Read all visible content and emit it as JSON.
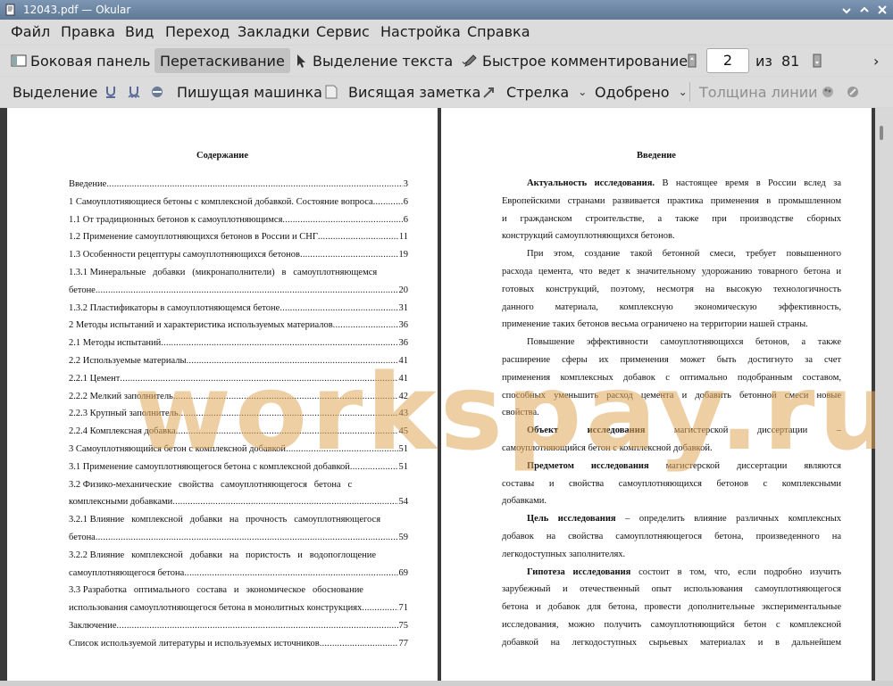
{
  "window": {
    "title": "12043.pdf  — Okular"
  },
  "menubar": {
    "items": [
      "Файл",
      "Правка",
      "Вид",
      "Переход",
      "Закладки",
      "Сервис",
      "Настройка",
      "Справка"
    ]
  },
  "toolbar1": {
    "sidebar": "Боковая панель",
    "drag": "Перетаскивание",
    "text_select": "Выделение текста",
    "quick_comment": "Быстрое комментирование",
    "page_value": "2",
    "page_of": "из",
    "page_total": "81"
  },
  "toolbar2": {
    "selection": "Выделение",
    "typewriter": "Пишущая машинка",
    "hanging_note": "Висящая заметка",
    "arrow": "Стрелка",
    "approved": "Одобрено",
    "line_width": "Толщина линии"
  },
  "left_page": {
    "heading": "Содержание",
    "toc": [
      {
        "title": "Введение",
        "page": "3"
      },
      {
        "title": "1 Самоуплотняющиеся бетоны с комплексной добавкой. Состояние вопроса",
        "page": "6"
      },
      {
        "title": "1.1 От традиционных бетонов к самоуплотняющимся",
        "page": "6"
      },
      {
        "title": "1.2 Применение самоуплотняющихся бетонов в России и СНГ",
        "page": "11"
      },
      {
        "title": "1.3 Особенности рецептуры самоуплотняющихся бетонов",
        "page": "19"
      },
      {
        "title": "1.3.1 Минеральные   добавки   (микронаполнители)   в   самоуплотняющемся",
        "page": ""
      },
      {
        "title": "бетоне",
        "page": "20"
      },
      {
        "title": "1.3.2 Пластификаторы в самоуплотняющемся бетоне",
        "page": "31"
      },
      {
        "title": "2 Методы испытаний и характеристика используемых материалов",
        "page": "36"
      },
      {
        "title": "2.1 Методы испытаний",
        "page": "36"
      },
      {
        "title": "2.2 Используемые материалы",
        "page": "41"
      },
      {
        "title": "2.2.1 Цемент",
        "page": "41"
      },
      {
        "title": "2.2.2 Мелкий заполнитель",
        "page": "42"
      },
      {
        "title": "2.2.3 Крупный заполнитель",
        "page": "43"
      },
      {
        "title": "2.2.4 Комплексная добавка",
        "page": "45"
      },
      {
        "title": "3 Самоуплотняющийся бетон с комплексной добавкой",
        "page": "51"
      },
      {
        "title": "3.1 Применение самоуплотняющегося бетона с комплексной добавкой",
        "page": "51"
      },
      {
        "title": "3.2 Физико-механические   свойства   самоуплотняющегося   бетона   с",
        "page": ""
      },
      {
        "title": "комплексными добавками",
        "page": "54"
      },
      {
        "title": "3.2.1 Влияние   комплексной   добавки   на   прочность   самоуплотняющегося",
        "page": ""
      },
      {
        "title": "бетона",
        "page": "59"
      },
      {
        "title": "3.2.2 Влияние   комплексной   добавки   на   пористость   и   водопоглощение",
        "page": ""
      },
      {
        "title": "самоуплотняющегося бетона",
        "page": "69"
      },
      {
        "title": "3.3 Разработка   оптимального   состава   и   экономическое   обоснование",
        "page": ""
      },
      {
        "title": "использования самоуплотняющегося бетона в монолитных конструкциях",
        "page": "71"
      },
      {
        "title": "Заключение",
        "page": "75"
      },
      {
        "title": "Список используемой литературы и используемых источников",
        "page": "77"
      }
    ]
  },
  "right_page": {
    "heading": "Введение",
    "lines": [
      {
        "b": "Актуальность исследования.",
        "t": " В настоящее время в России вслед за",
        "indent": true
      },
      {
        "b": "",
        "t": "Европейскими странами развивается практика применения в промышленном"
      },
      {
        "b": "",
        "t": "и   гражданском   строительстве,   а   также   при   производстве   сборных"
      },
      {
        "b": "",
        "t": "конструкций самоуплотняющихся бетонов.",
        "last": true
      },
      {
        "b": "",
        "t": "При этом, создание такой бетонной смеси, требует повышенного",
        "indent": true
      },
      {
        "b": "",
        "t": "расхода цемента, что ведет к значительному удорожанию товарного бетона и"
      },
      {
        "b": "",
        "t": "готовых конструкций, поэтому, несмотря на высокую технологичность"
      },
      {
        "b": "",
        "t": "данного   материала,   комплексную   экономическую   эффективность,"
      },
      {
        "b": "",
        "t": "применение таких бетонов весьма ограничено на территории нашей страны.",
        "last": true
      },
      {
        "b": "",
        "t": "Повышение эффективности самоуплотняющихся бетонов, а также",
        "indent": true
      },
      {
        "b": "",
        "t": "расширение   сферы   их   применения   может   быть   достигнуто   за   счет"
      },
      {
        "b": "",
        "t": "применения комплексных добавок с оптимально подобранным составом,"
      },
      {
        "b": "",
        "t": "способных уменьшить расход цемента и добавить бетонной смеси новые"
      },
      {
        "b": "",
        "t": "свойства.",
        "last": true
      },
      {
        "b": "Объект     исследования",
        "t": "     магистерской     диссертации     –",
        "indent": true
      },
      {
        "b": "",
        "t": "самоуплотняющийся бетон с комплексной добавкой.",
        "last": true
      },
      {
        "b": "Предметом исследования",
        "t": " магистерской диссертации являются",
        "indent": true
      },
      {
        "b": "",
        "t": "составы   и   свойства   самоуплотняющихся   бетонов   с   комплексными"
      },
      {
        "b": "",
        "t": "добавками.",
        "last": true
      },
      {
        "b": "Цель исследования",
        "t": " – определить влияние различных комплексных",
        "indent": true
      },
      {
        "b": "",
        "t": "добавок  на  свойства  самоуплотняющегося  бетона,  произведенного  на"
      },
      {
        "b": "",
        "t": "легкодоступных заполнителях.",
        "last": true
      },
      {
        "b": "Гипотеза исследования",
        "t": " состоит в том, что, если подробно изучить",
        "indent": true
      },
      {
        "b": "",
        "t": "зарубежный и отечественный опыт использования самоуплотняющегося"
      },
      {
        "b": "",
        "t": "бетона и добавок для бетона, провести дополнительные экспериментальные"
      },
      {
        "b": "",
        "t": "исследования, можно получить самоуплотняющийся бетон с комплексной"
      },
      {
        "b": "",
        "t": "добавкой  на  легкодоступных  сырьевых  материалах  и  в  дальнейшем"
      }
    ]
  },
  "watermark": "workspay.ru"
}
